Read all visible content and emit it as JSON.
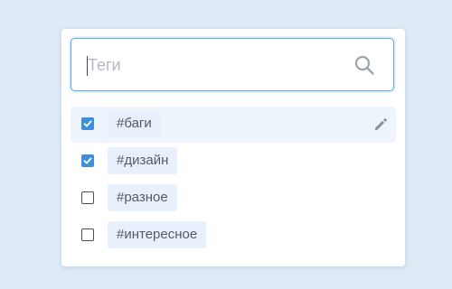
{
  "search": {
    "placeholder": "Теги",
    "value": "",
    "icon": "search-icon"
  },
  "tags": [
    {
      "label": "#баги",
      "checked": true,
      "hovered": true
    },
    {
      "label": "#дизайн",
      "checked": true,
      "hovered": false
    },
    {
      "label": "#разное",
      "checked": false,
      "hovered": false
    },
    {
      "label": "#интересное",
      "checked": false,
      "hovered": false
    }
  ],
  "colors": {
    "accent": "#3d8fdc",
    "tag_background": "#e8f1fb",
    "hover_background": "#eef4fb",
    "page_background": "#dfeaf7"
  },
  "edit_icon": "pencil-icon"
}
